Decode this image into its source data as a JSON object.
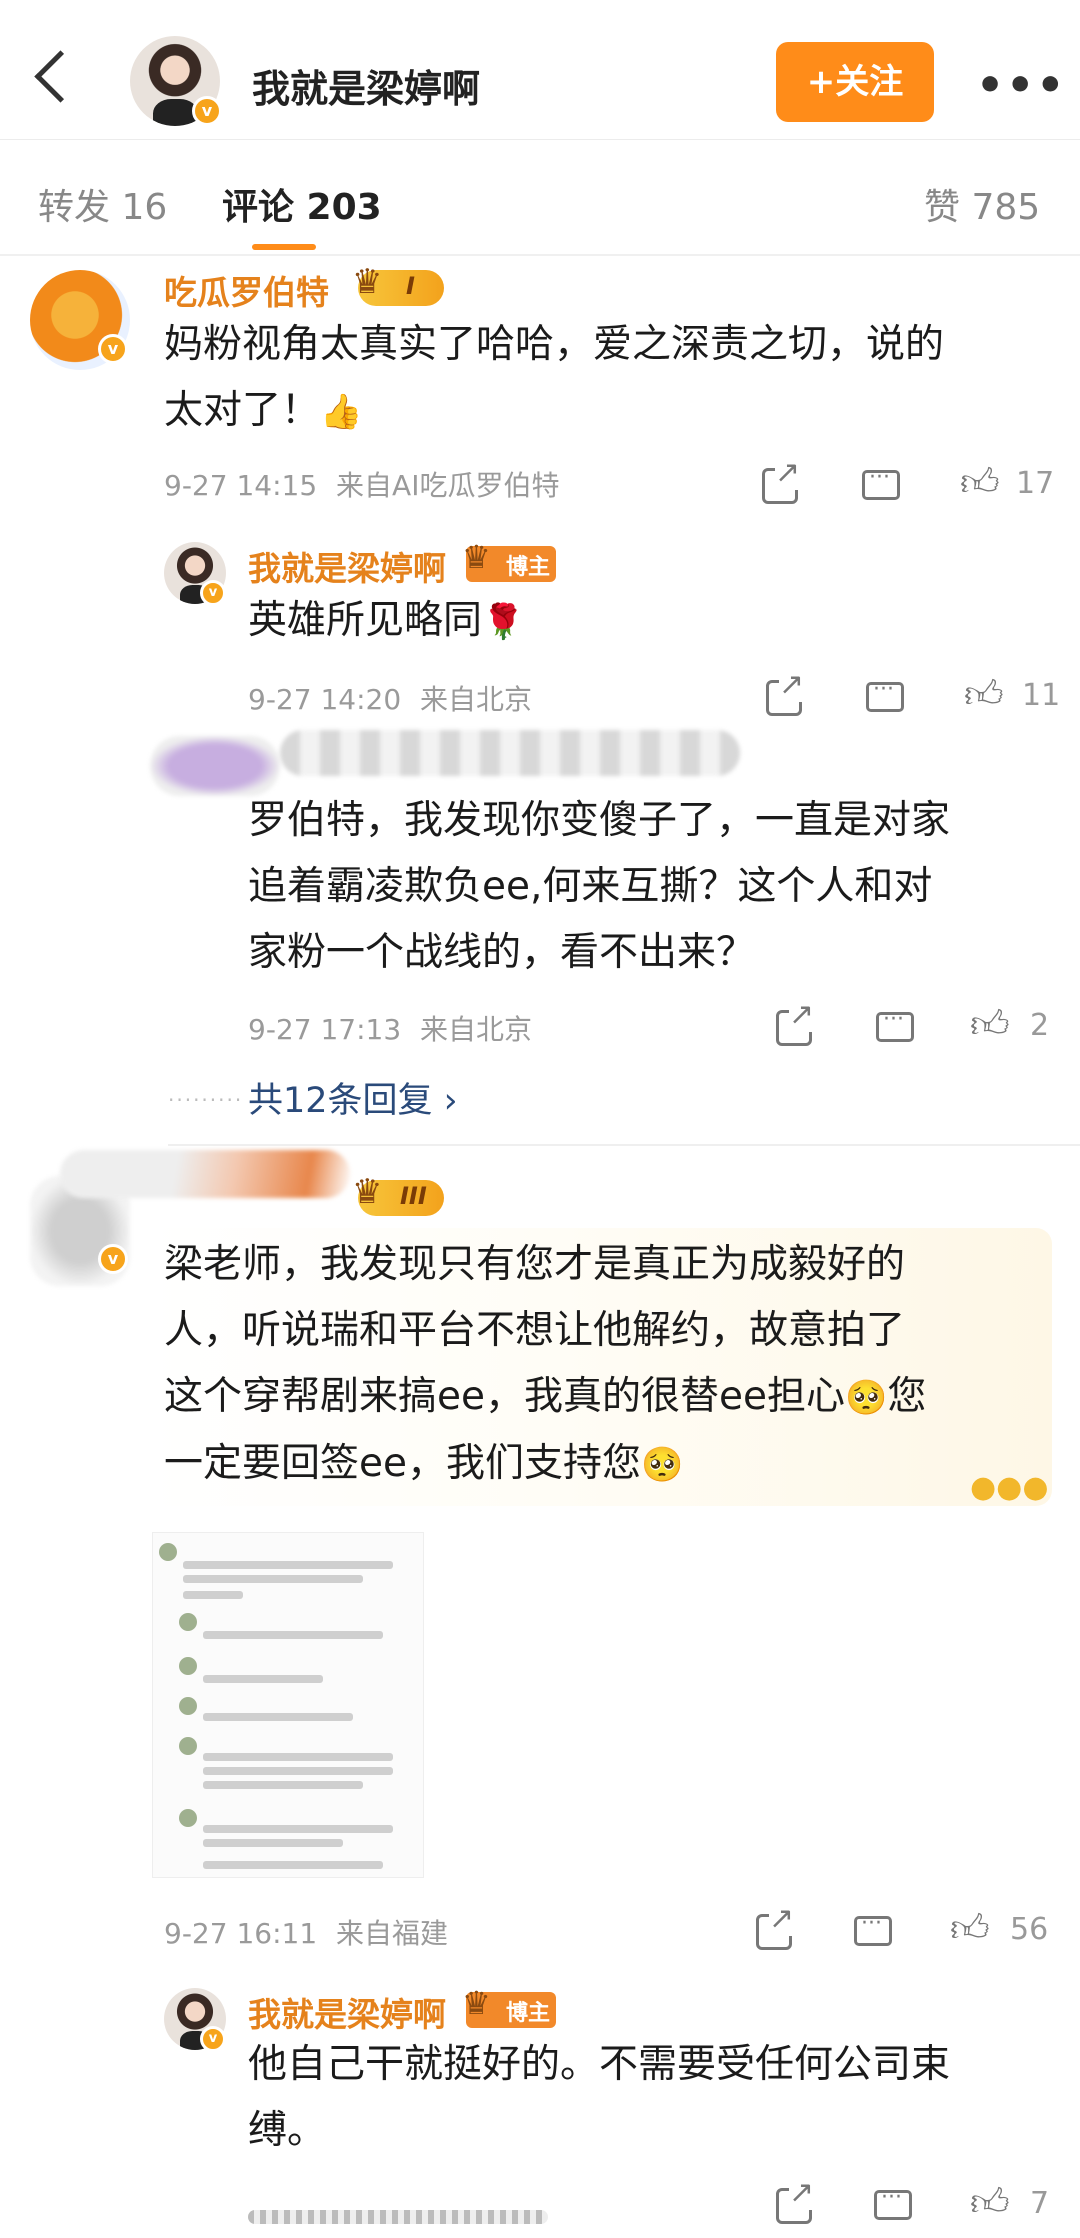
{
  "header": {
    "name": "我就是梁婷啊",
    "follow_label": "+关注",
    "more_label": "•••"
  },
  "tabs": {
    "repost": "转发 16",
    "comments": "评论 203",
    "likes": "赞 785"
  },
  "comments": [
    {
      "user": "吃瓜罗伯特",
      "level": "I",
      "text_line1": "妈粉视角太真实了哈哈，爱之深责之切，说的",
      "text_line2": "太对了！",
      "emoji": "👍",
      "time": "9-27 14:15",
      "source": "来自AI吃瓜罗伯特",
      "likes": "17",
      "replies": [
        {
          "user": "我就是梁婷啊",
          "badge": "博主",
          "text": "英雄所见略同",
          "emoji": "🌹",
          "time": "9-27 14:20",
          "source": "来自北京",
          "likes": "11"
        },
        {
          "text_line1": "罗伯特，我发现你变傻子了，一直是对家",
          "text_line2": "追着霸凌欺负ee,何来互撕？这个人和对",
          "text_line3": "家粉一个战线的，看不出来？",
          "time": "9-27 17:13",
          "source": "来自北京",
          "likes": "2"
        }
      ],
      "more_replies": "共12条回复 ›"
    },
    {
      "level": "III",
      "text_line1": "梁老师，我发现只有您才是真正为成毅好的",
      "text_line2": "人，听说瑞和平台不想让他解约，故意拍了",
      "text_line3": "这个穿帮剧来搞ee，我真的很替ee担心",
      "text_line3_tail": "您",
      "text_line4": "一定要回签ee，我们支持您",
      "emoji_worried": "🥺",
      "time": "9-27 16:11",
      "source": "来自福建",
      "likes": "56",
      "reply": {
        "user": "我就是梁婷啊",
        "badge": "博主",
        "text_line1": "他自己干就挺好的。不需要受任何公司束",
        "text_line2": "缚。",
        "likes": "7"
      }
    }
  ],
  "colors": {
    "accent": "#ff8c19",
    "username": "#e5821c",
    "link": "#2a4a7a"
  },
  "icons": [
    "back-arrow-icon",
    "share-icon",
    "comment-icon",
    "like-icon",
    "crown-icon"
  ]
}
